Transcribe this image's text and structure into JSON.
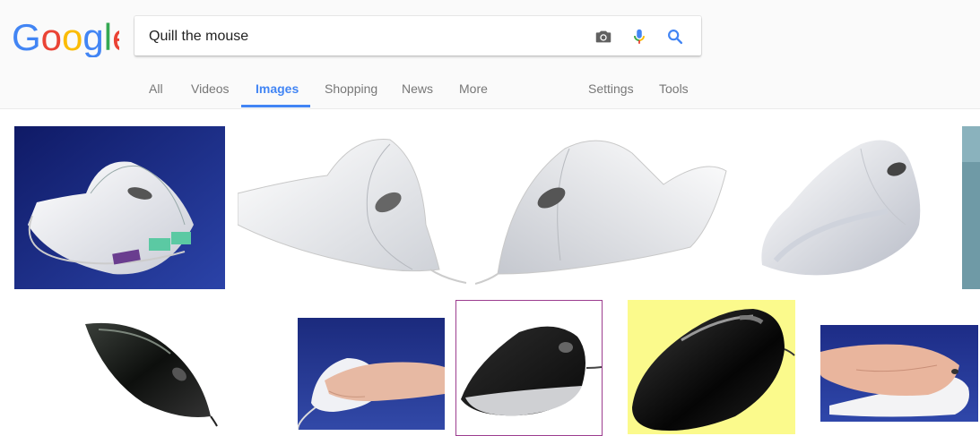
{
  "search": {
    "query": "Quill the mouse"
  },
  "logo": {
    "text": "Google"
  },
  "tabs": [
    {
      "label": "All"
    },
    {
      "label": "Videos"
    },
    {
      "label": "Images"
    },
    {
      "label": "Shopping"
    },
    {
      "label": "News"
    },
    {
      "label": "More"
    }
  ],
  "tools": {
    "settings": "Settings",
    "tools": "Tools"
  },
  "icons": {
    "camera": "camera-icon",
    "mic": "microphone-icon",
    "search": "search-icon"
  },
  "colors": {
    "accent": "#4285f4",
    "google_blue": "#4285f4",
    "google_red": "#ea4335",
    "google_yellow": "#fbbc05",
    "google_green": "#34a853"
  }
}
